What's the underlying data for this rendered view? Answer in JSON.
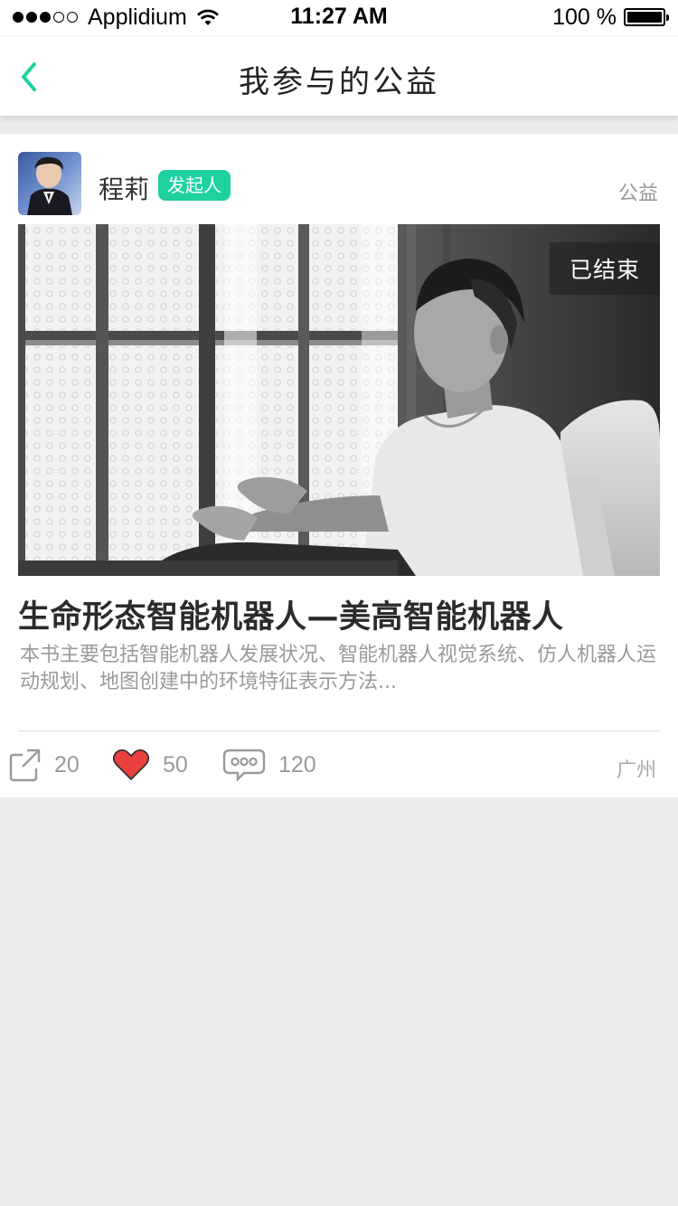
{
  "status_bar": {
    "carrier": "Applidium",
    "time": "11:27 AM",
    "battery": "100 %",
    "signal_bars_filled": 3,
    "signal_bars_total": 5
  },
  "nav": {
    "title": "我参与的公益",
    "back_icon": "chevron-left-icon",
    "accent_color": "#1fd1a0"
  },
  "post": {
    "author": "程莉",
    "role_badge": "发起人",
    "category": "公益",
    "status": "已结束",
    "title": "生命形态智能机器人—美高智能机器人",
    "description": "本书主要包括智能机器人发展状况、智能机器人视觉系统、仿人机器人运动规划、地图创建中的环境特征表示方法...",
    "shares": "20",
    "likes": "50",
    "comments": "120",
    "location": "广州"
  }
}
